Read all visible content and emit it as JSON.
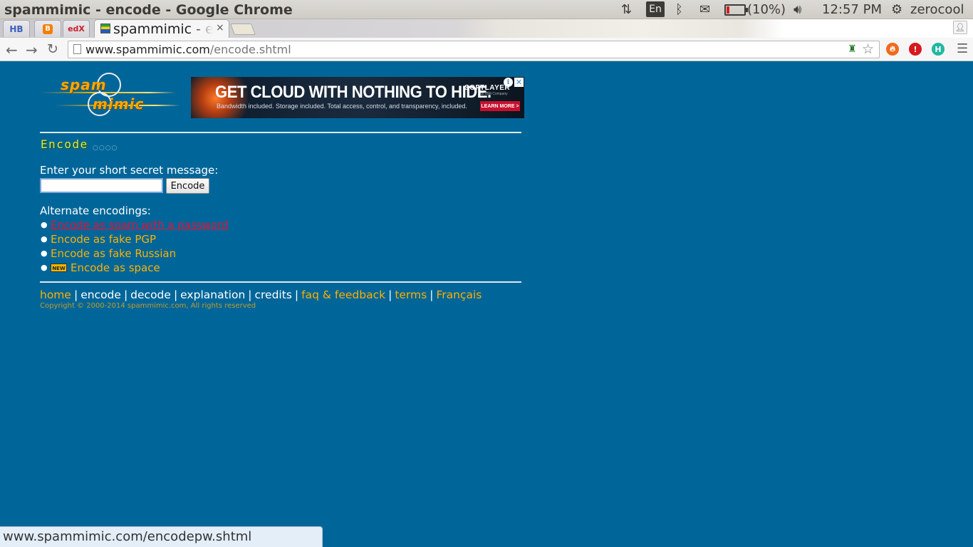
{
  "window": {
    "title": "spammimic - encode - Google Chrome"
  },
  "system_tray": {
    "language": "En",
    "battery": "(10%)",
    "clock": "12:57 PM",
    "user": "zerocool",
    "icons": [
      "network-updown-icon",
      "bluetooth-icon",
      "mail-icon",
      "battery-icon",
      "volume-icon",
      "gear-icon"
    ]
  },
  "tabs": {
    "pinned": [
      {
        "name": "hb",
        "icon_text": "HB"
      },
      {
        "name": "blogger",
        "icon_text": "B"
      },
      {
        "name": "edx",
        "icon_text": "edX"
      }
    ],
    "active": {
      "title": "spammimic - encode",
      "close": "×"
    }
  },
  "toolbar": {
    "url_host": "www.spammimic.com",
    "url_path": "/encode.shtml",
    "extensions": [
      "fire-extension-icon",
      "stop-extension-icon",
      "h-extension-icon"
    ],
    "ext_h_label": "H",
    "ext_stop_label": "!"
  },
  "logo": {
    "word1": "spam",
    "word2": "mimic"
  },
  "ad": {
    "headline": "GET CLOUD WITH NOTHING TO HIDE.",
    "subtext": "Bandwidth included. Storage included. Total access, control, and transparency, included.",
    "brand": "SOFTLAYER",
    "brand_sub": "an IBM Company",
    "cta": "LEARN MORE >",
    "info": "i",
    "close": "✕"
  },
  "main": {
    "section_title": "Encode",
    "prompt": "Enter your short secret message:",
    "input_value": "",
    "button_label": "Encode",
    "alt_label": "Alternate encodings:",
    "alternates": [
      {
        "pre": "Encode as spam ",
        "em": "with",
        "post": " a password"
      },
      {
        "text": "Encode as fake PGP"
      },
      {
        "text": "Encode as fake Russian"
      },
      {
        "badge": "NEW",
        "text": "Encode as space"
      }
    ]
  },
  "footer": {
    "nav": [
      "home",
      "encode",
      "decode",
      "explanation",
      "credits",
      "faq & feedback",
      "terms",
      "Français"
    ],
    "copyright": "Copyright © 2000-2014 spammimic.com, All rights reserved"
  },
  "status": {
    "hover_url": "www.spammimic.com/encodepw.shtml"
  },
  "colors": {
    "page_bg": "#006699",
    "link": "#ffb000",
    "hover_link": "#e3133a",
    "title": "#d8ef3a"
  }
}
